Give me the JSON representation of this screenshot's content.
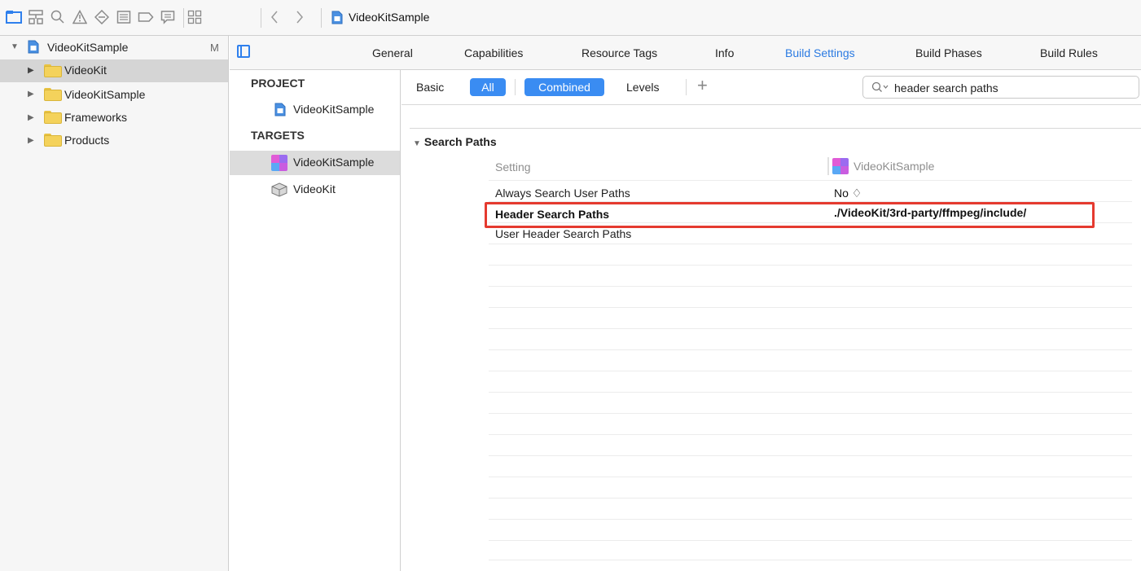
{
  "toolbar": {
    "breadcrumb_title": "VideoKitSample",
    "nav_icons": [
      "folder-icon",
      "hierarchy-icon",
      "search-icon",
      "warning-icon",
      "breakpoint-icon",
      "list-icon",
      "tag-icon",
      "comment-icon"
    ],
    "grid_icon": "grid-icon",
    "back_icon": "chevron-left-icon",
    "forward_icon": "chevron-right-icon"
  },
  "navigator": {
    "project": {
      "label": "VideoKitSample",
      "badge": "M"
    },
    "items": [
      {
        "label": "VideoKit",
        "selected": true
      },
      {
        "label": "VideoKitSample",
        "selected": false
      },
      {
        "label": "Frameworks",
        "selected": false
      },
      {
        "label": "Products",
        "selected": false
      }
    ]
  },
  "targets_list": {
    "project_header": "PROJECT",
    "project_item": "VideoKitSample",
    "targets_header": "TARGETS",
    "targets": [
      {
        "label": "VideoKitSample",
        "selected": true
      },
      {
        "label": "VideoKit",
        "selected": false
      }
    ]
  },
  "tabs": [
    {
      "label": "General",
      "active": false
    },
    {
      "label": "Capabilities",
      "active": false
    },
    {
      "label": "Resource Tags",
      "active": false
    },
    {
      "label": "Info",
      "active": false
    },
    {
      "label": "Build Settings",
      "active": true
    },
    {
      "label": "Build Phases",
      "active": false
    },
    {
      "label": "Build Rules",
      "active": false
    }
  ],
  "filter_bar": {
    "basic": "Basic",
    "all": "All",
    "combined": "Combined",
    "levels": "Levels",
    "add": "+",
    "search_value": "header search paths"
  },
  "settings": {
    "group_title": "Search Paths",
    "column_setting": "Setting",
    "column_target": "VideoKitSample",
    "rows": [
      {
        "name": "Always Search User Paths",
        "value": "No ♢"
      },
      {
        "name": "Header Search Paths",
        "value": "./VideoKit/3rd-party/ffmpeg/include/"
      },
      {
        "name": "User Header Search Paths",
        "value": ""
      }
    ]
  },
  "colors": {
    "accent": "#2a7ae2",
    "pill": "#3a8cf2",
    "highlight_border": "#e53a2f",
    "folder": "#f4d25b",
    "selection": "#d5d5d5"
  }
}
